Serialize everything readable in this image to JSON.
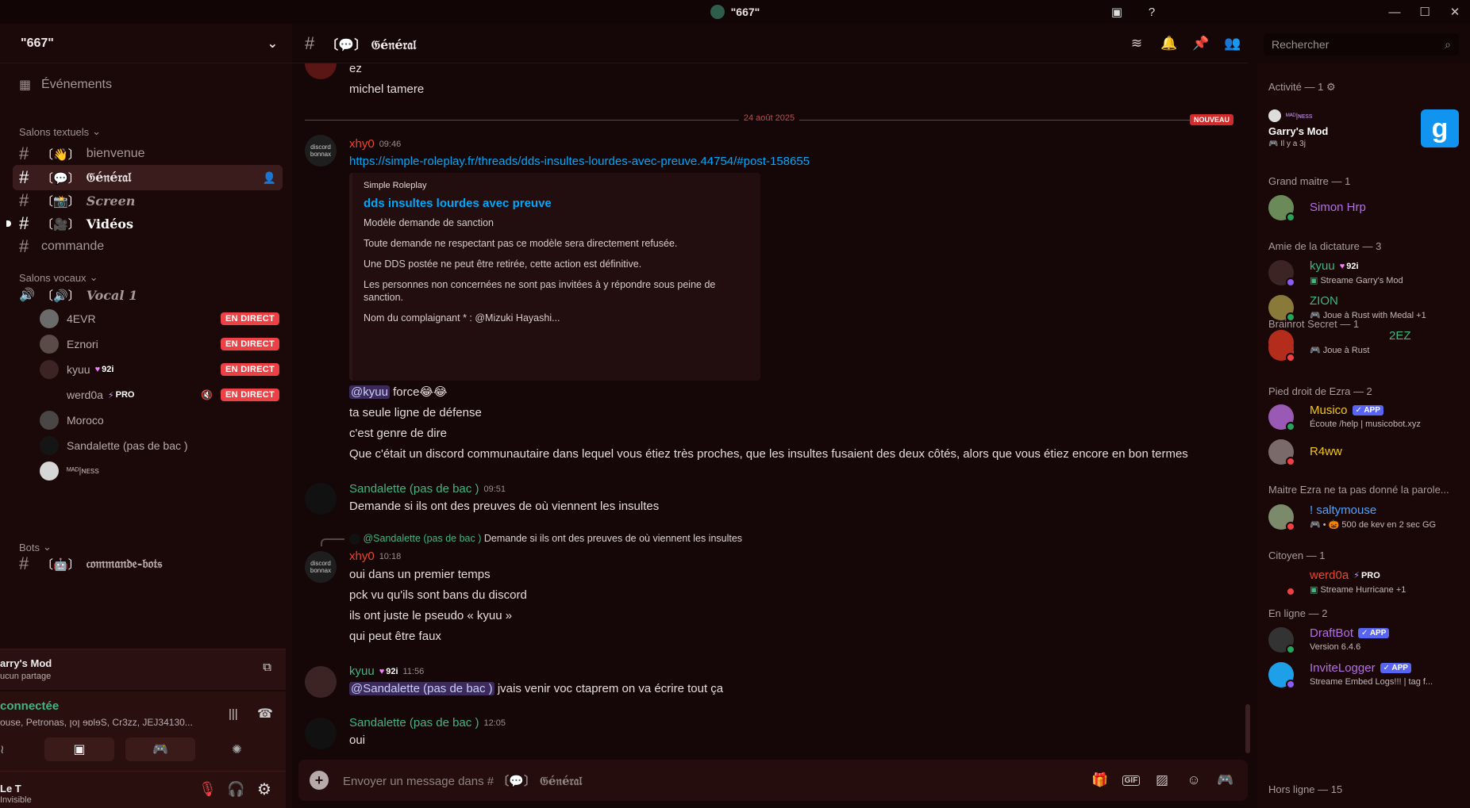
{
  "window": {
    "title": "\"667\"",
    "controls": [
      "—",
      "☐",
      "✕"
    ]
  },
  "sidebar": {
    "server_name": "\"667\"",
    "events_label": "Événements",
    "text_category": "Salons textuels",
    "text_channels": [
      {
        "emoji": "〔👋〕",
        "name": "bienvenue"
      },
      {
        "emoji": "〔💬〕",
        "name": "𝔊é𝔫é𝔯𝔞𝔩"
      },
      {
        "emoji": "〔📸〕",
        "name": "Screen"
      },
      {
        "emoji": "〔🎥〕",
        "name": "Vidéos"
      },
      {
        "emoji": "",
        "name": "commande"
      }
    ],
    "voice_category": "Salons vocaux",
    "voice_channel": {
      "emoji": "〔🔊〕",
      "name": "Vocal 1"
    },
    "voice_users": [
      {
        "name": "4EVR",
        "badge": "",
        "live": "EN DIRECT"
      },
      {
        "name": "Eznori",
        "badge": "",
        "live": "EN DIRECT"
      },
      {
        "name": "kyuu",
        "badge": "92i",
        "live": "EN DIRECT"
      },
      {
        "name": "werd0a",
        "badge": "PRO",
        "live": "EN DIRECT"
      },
      {
        "name": "Moroco",
        "badge": "",
        "live": ""
      },
      {
        "name": "Sandalette (pas de bac )",
        "badge": "",
        "live": ""
      },
      {
        "name": "ᴹᴬᴰ|ɴᴇss",
        "badge": "",
        "live": ""
      }
    ],
    "bots_category": "Bots",
    "bots_channel": {
      "emoji": "〔🤖〕",
      "name": "𝔠𝔬𝔪𝔪𝔞𝔫𝔡𝔢-𝔟𝔬𝔱𝔰"
    },
    "activity": {
      "title": "arry's Mod",
      "sub": "ucun partage"
    },
    "voice_status": {
      "title": "connectée",
      "sub": "ouse, Petronas, ꞁoꞁ ɘɒlɘS, Cr3zz, JEJ34130..."
    },
    "user": {
      "name": "Le T",
      "status": "Invisible"
    }
  },
  "channel": {
    "name": "〔💬〕 𝔊é𝔫é𝔯𝔞𝔩"
  },
  "search": {
    "placeholder": "Rechercher"
  },
  "messages": {
    "top_lines": [
      "ez",
      "michel tamere"
    ],
    "date": "24 août 2025",
    "new_badge": "NOUVEAU",
    "m1": {
      "author": "xhy0",
      "time": "09:46",
      "link": "https://simple-roleplay.fr/threads/dds-insultes-lourdes-avec-preuve.44754/#post-158655",
      "embed": {
        "provider": "Simple Roleplay",
        "title": "dds insultes lourdes avec preuve",
        "paras": [
          "Modèle demande de sanction",
          "Toute demande ne respectant pas ce modèle sera directement refusée.",
          "Une DDS postée ne peut être retirée, cette action est définitive.",
          "Les personnes non concernées ne sont pas invitées à y répondre sous peine de sanction.",
          "Nom du complaignant * : @Mizuki Hayashi..."
        ]
      },
      "mention": "@kyuu",
      "mention_rest": " force😂😂",
      "lines": [
        "ta seule ligne de défense",
        "c'est genre de dire",
        "Que c'était un discord communautaire dans lequel vous étiez très proches, que les insultes fusaient des deux côtés, alors que vous étiez encore en bon termes"
      ]
    },
    "m2": {
      "author": "Sandalette (pas de bac )",
      "time": "09:51",
      "text": "Demande si ils ont des preuves de où viennent les insultes"
    },
    "m3": {
      "reply_author": "@Sandalette (pas de bac )",
      "reply_text": "Demande si ils ont des preuves de où viennent les insultes",
      "author": "xhy0",
      "time": "10:18",
      "lines": [
        "oui dans un premier temps",
        "pck vu qu'ils sont bans du discord",
        "ils ont juste le pseudo « kyuu »",
        "qui peut être faux"
      ]
    },
    "m4": {
      "author": "kyuu",
      "badge": "92i",
      "time": "11:56",
      "mention": "@Sandalette (pas de bac )",
      "text": " jvais venir voc ctaprem on va écrire tout ça"
    },
    "m5": {
      "author": "Sandalette (pas de bac )",
      "time": "12:05",
      "text": "oui"
    },
    "avatar_text": "discord bonnax"
  },
  "composer": {
    "placeholder_prefix": "Envoyer un message dans # ",
    "channel": "〔💬〕 𝔊é𝔫é𝔯𝔞𝔩",
    "gif": "GIF"
  },
  "members": {
    "activity_header": "Activité — 1",
    "activity": {
      "user": "ᴹᴬᴰ|ɴᴇss",
      "game": "Garry's Mod",
      "time": "Il y a 3j"
    },
    "groups": [
      {
        "title": "Grand maitre — 1"
      },
      {
        "title": "Amie de la dictature — 3"
      },
      {
        "title": "Brainrot Secret — 1"
      },
      {
        "title": "Pied droit de Ezra — 2"
      },
      {
        "title": "Maitre Ezra ne ta pas donné la parole..."
      },
      {
        "title": "Citoyen — 1"
      },
      {
        "title": "En ligne — 2"
      },
      {
        "title": "Hors ligne — 15"
      }
    ],
    "list": [
      {
        "name": "Simon Hrp",
        "status": "",
        "color": "#b46ee8"
      },
      {
        "name": "kyuu",
        "badge": "92i",
        "status": "Streame Garry's Mod",
        "color": "#43b581"
      },
      {
        "name": "ZION",
        "status": "Joue à Rust with Medal +1",
        "color": "#43b581"
      },
      {
        "name": "2EZ",
        "status": "Joue à Rust",
        "color": "#43b581"
      },
      {
        "name": "",
        "status": "",
        "color": "#ffffff"
      },
      {
        "name": "Musico",
        "badge": "APP",
        "status": "Écoute /help | musicobot.xyz",
        "color": "#f0c814"
      },
      {
        "name": "R4ww",
        "status": "",
        "color": "#f0c814"
      },
      {
        "name": "! saltymouse",
        "status": "• 🎃 500 de kev en 2 sec GG",
        "color": "#4fa3ff"
      },
      {
        "name": "werd0a",
        "badge": "PRO",
        "status": "Streame Hurricane +1",
        "color": "#e8472e"
      },
      {
        "name": "DraftBot",
        "badge": "APP",
        "status": "Version 6.4.6",
        "color": "#b46ee8"
      },
      {
        "name": "InviteLogger",
        "badge": "APP",
        "status": "Streame Embed Logs!!! | tag f...",
        "color": "#b46ee8"
      }
    ]
  },
  "colors": {
    "accent": "#ed4245",
    "link": "#00a8fc",
    "green_name": "#43b581",
    "orange_name": "#e8472e"
  }
}
